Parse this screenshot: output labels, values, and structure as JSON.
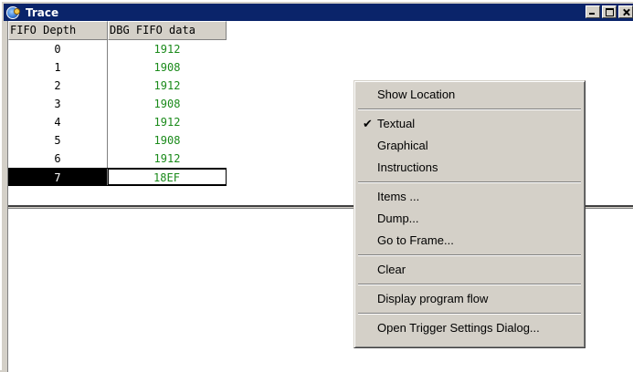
{
  "window": {
    "title": "Trace"
  },
  "table": {
    "columns": [
      "FIFO Depth",
      "DBG FIFO data"
    ],
    "rows": [
      {
        "depth": "0",
        "data": "1912"
      },
      {
        "depth": "1",
        "data": "1908"
      },
      {
        "depth": "2",
        "data": "1912"
      },
      {
        "depth": "3",
        "data": "1908"
      },
      {
        "depth": "4",
        "data": "1912"
      },
      {
        "depth": "5",
        "data": "1908"
      },
      {
        "depth": "6",
        "data": "1912"
      },
      {
        "depth": "7",
        "data": "18EF"
      }
    ]
  },
  "context_menu": {
    "items": [
      {
        "label": "Show Location"
      },
      {
        "label": "Textual",
        "check": "✔"
      },
      {
        "label": "Graphical"
      },
      {
        "label": "Instructions"
      },
      {
        "label": "Items ..."
      },
      {
        "label": "Dump..."
      },
      {
        "label": "Go to Frame..."
      },
      {
        "label": "Clear"
      },
      {
        "label": "Display program flow"
      },
      {
        "label": "Open Trigger Settings Dialog..."
      }
    ]
  },
  "colors": {
    "titlebar": "#0a246a",
    "data_text": "#1a8a1a",
    "selection": "#000000",
    "face": "#d4d0c8"
  }
}
